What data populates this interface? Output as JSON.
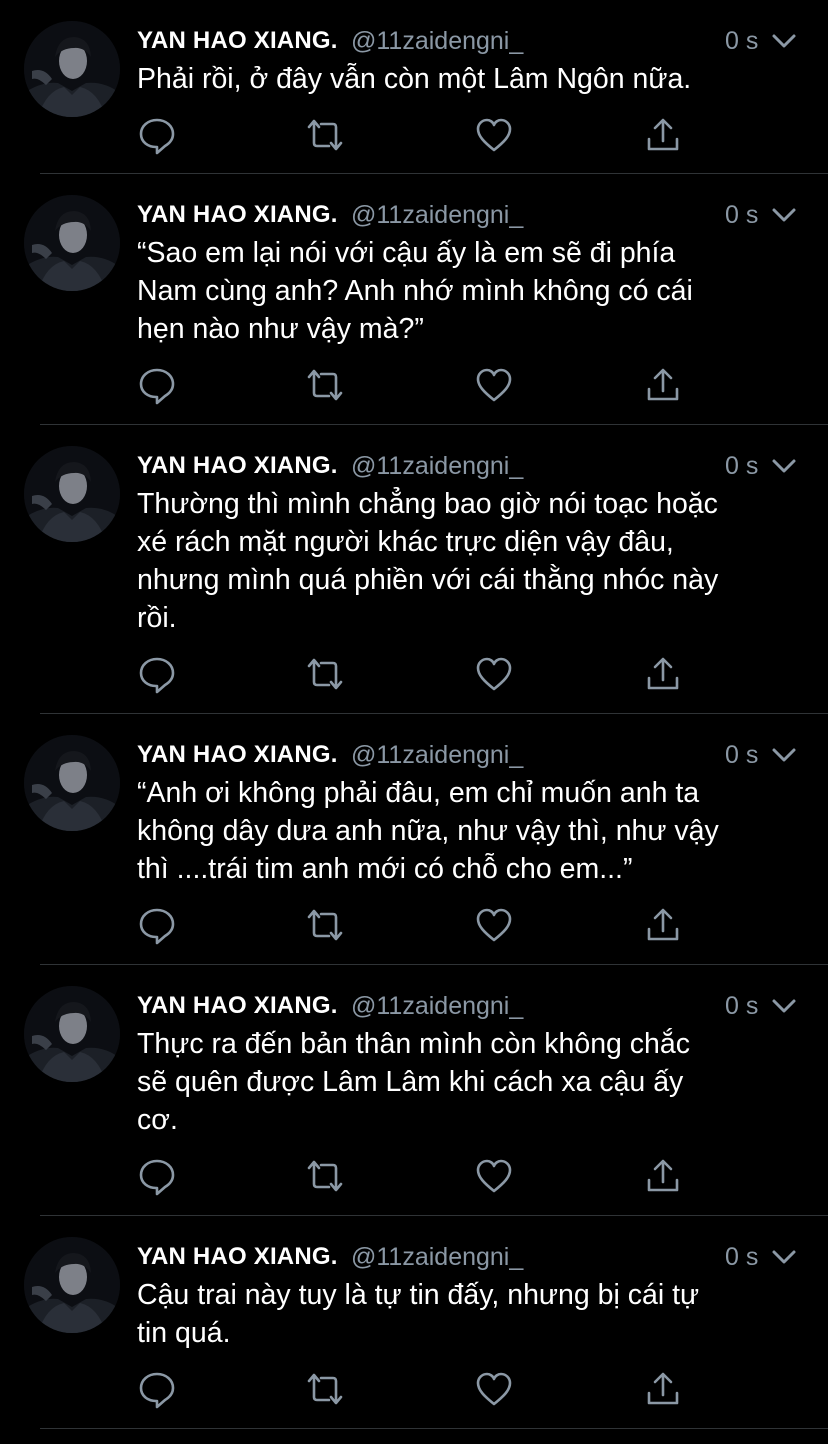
{
  "colors": {
    "background": "#000000",
    "text": "#ffffff",
    "secondary_text": "#8b98a5",
    "divider": "#2f3336"
  },
  "icons": {
    "avatar": "profile-photo",
    "caret": "chevron-down-icon",
    "reply": "reply-icon",
    "retweet": "retweet-icon",
    "like": "heart-icon",
    "share": "share-icon"
  },
  "tweets": [
    {
      "name": "YAN HAO XIANG.",
      "handle": "@11zaidengni_",
      "time": "0 s",
      "text": "Phải rồi, ở đây vẫn còn một Lâm Ngôn nữa."
    },
    {
      "name": "YAN HAO XIANG.",
      "handle": "@11zaidengni_",
      "time": "0 s",
      "text": "“Sao em lại nói với cậu ấy là em sẽ đi phía\nNam cùng anh? Anh nhớ mình không có cái\nhẹn nào như vậy mà?”"
    },
    {
      "name": "YAN HAO XIANG.",
      "handle": "@11zaidengni_",
      "time": "0 s",
      "text": "Thường thì mình chẳng bao giờ nói toạc hoặc\nxé rách mặt người khác trực diện vậy đâu,\nnhưng mình quá phiền với cái thằng nhóc này\nrồi."
    },
    {
      "name": "YAN HAO XIANG.",
      "handle": "@11zaidengni_",
      "time": "0 s",
      "text": "“Anh ơi không phải đâu, em chỉ muốn anh ta\nkhông dây dưa anh nữa, như vậy thì, như vậy\nthì ....trái tim anh mới có chỗ cho em...”"
    },
    {
      "name": "YAN HAO XIANG.",
      "handle": "@11zaidengni_",
      "time": "0 s",
      "text": "Thực ra đến bản thân mình còn không chắc\nsẽ quên được Lâm Lâm khi cách xa cậu ấy\ncơ."
    },
    {
      "name": "YAN HAO XIANG.",
      "handle": "@11zaidengni_",
      "time": "0 s",
      "text": "Cậu trai này tuy là tự tin đấy, nhưng bị cái tự\ntin quá."
    }
  ]
}
